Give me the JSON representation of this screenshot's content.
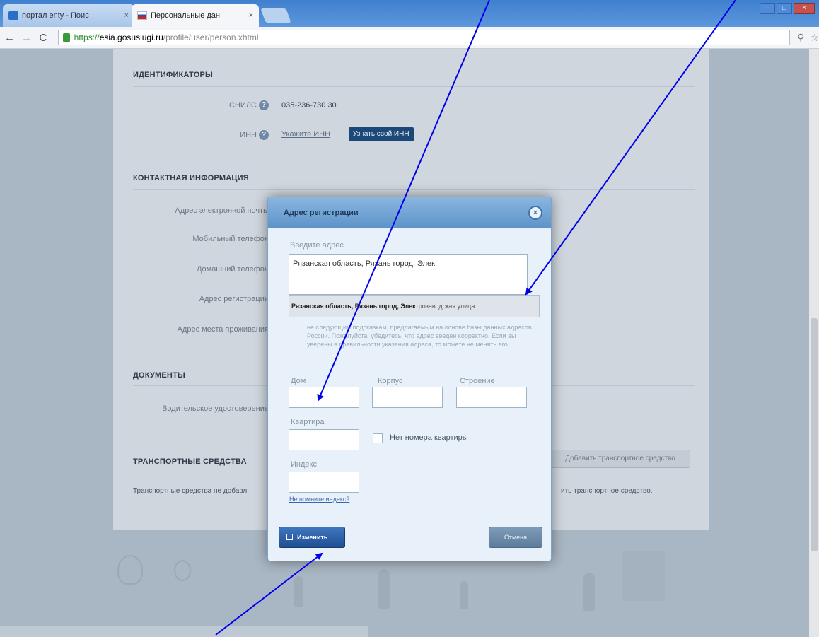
{
  "browser": {
    "tabs": [
      {
        "label": "портал enty - Поис",
        "active": false,
        "icon": "search-icon"
      },
      {
        "label": "Персональные дан",
        "active": true,
        "icon": "russia-flag-icon"
      }
    ],
    "url": {
      "scheme": "https://",
      "host": "esia.gosuslugi.ru",
      "path": "/profile/user/person.xhtml"
    }
  },
  "profile": {
    "identifiers": {
      "title": "ИДЕНТИФИКАТОРЫ",
      "snils_label": "СНИЛС",
      "snils_value": "035-236-730 30",
      "inn_label": "ИНН",
      "inn_link": "Укажите ИНН",
      "inn_button": "Узнать свой ИНН"
    },
    "contact": {
      "title": "КОНТАКТНАЯ ИНФОРМАЦИЯ",
      "email_label": "Адрес электронной почты",
      "mobile_label": "Мобильный телефон",
      "home_phone_label": "Домашний телефон",
      "reg_address_label": "Адрес регистрации",
      "residence_label": "Адрес места проживания"
    },
    "documents": {
      "title": "ДОКУМЕНТЫ",
      "license_label": "Водительское удостоверение"
    },
    "vehicles": {
      "title": "ТРАНСПОРТНЫЕ СРЕДСТВА",
      "add_button": "Добавить транспортное средство",
      "note_left": "Транспортные средства не добавл",
      "note_right": "ить транспортное средство."
    }
  },
  "modal": {
    "title": "Адрес регистрации",
    "address_label": "Введите адрес",
    "address_value": "Рязанская область, Рязань город, Элек",
    "suggestion_bold": "Рязанская область, Рязань город, Элек",
    "suggestion_rest": "трозаводская улица",
    "warning": "не следующим подсказкам, предлагаемым на основе базы данных адресов России. Пожалуйста, убедитесь, что адрес введен корректно. Если вы уверены в правильности указания адреса, то можете не менять его",
    "house_label": "Дом",
    "building_label": "Корпус",
    "structure_label": "Строение",
    "apartment_label": "Квартира",
    "no_apartment_label": "Нет номера квартиры",
    "index_label": "Индекс",
    "index_link": "Не помните индекс?",
    "apply_button": "Изменить",
    "cancel_button": "Отмена"
  },
  "colors": {
    "annotation_arrow": "#0000ee",
    "modal_header": "#5e93c8",
    "apply_button": "#1f4f93"
  }
}
